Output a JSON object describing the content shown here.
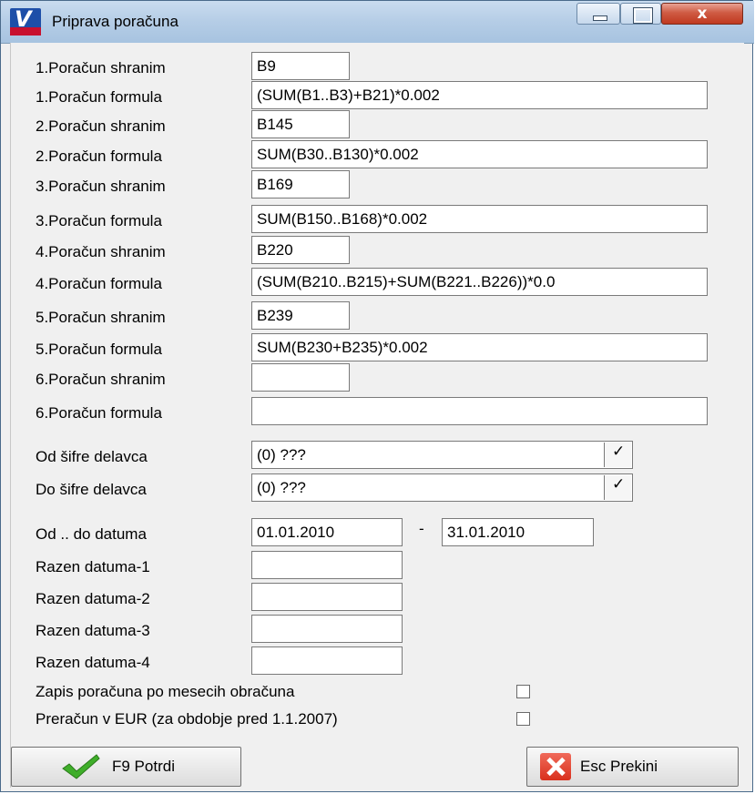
{
  "window": {
    "title": "Priprava poračuna"
  },
  "calculations": [
    {
      "store_label": "1.Poračun shranim",
      "store_value": "B9",
      "formula_label": "1.Poračun formula",
      "formula_value": "(SUM(B1..B3)+B21)*0.002"
    },
    {
      "store_label": "2.Poračun shranim",
      "store_value": "B145",
      "formula_label": "2.Poračun formula",
      "formula_value": "SUM(B30..B130)*0.002"
    },
    {
      "store_label": "3.Poračun shranim",
      "store_value": "B169",
      "formula_label": "3.Poračun formula",
      "formula_value": "SUM(B150..B168)*0.002"
    },
    {
      "store_label": "4.Poračun shranim",
      "store_value": "B220",
      "formula_label": "4.Poračun formula",
      "formula_value": "(SUM(B210..B215)+SUM(B221..B226))*0.0"
    },
    {
      "store_label": "5.Poračun shranim",
      "store_value": "B239",
      "formula_label": "5.Poračun formula",
      "formula_value": "SUM(B230+B235)*0.002"
    },
    {
      "store_label": "6.Poračun shranim",
      "store_value": "",
      "formula_label": "6.Poračun formula",
      "formula_value": ""
    }
  ],
  "workers": {
    "from_label": "Od šifre delavca",
    "from_value": "(0) ???",
    "to_label": "Do šifre delavca",
    "to_value": "(0) ???",
    "dropdown_glyph": "✓"
  },
  "dates": {
    "range_label": "Od .. do datuma",
    "from": "01.01.2010",
    "separator": "-",
    "to": "31.01.2010",
    "except_1_label": "Razen datuma-1",
    "except_1": "",
    "except_2_label": "Razen datuma-2",
    "except_2": "",
    "except_3_label": "Razen datuma-3",
    "except_3": "",
    "except_4_label": "Razen datuma-4",
    "except_4": ""
  },
  "options": {
    "monthly_label": "Zapis poračuna po mesecih obračuna",
    "monthly_checked": false,
    "eur_label": "Preračun v EUR (za obdobje pred 1.1.2007)",
    "eur_checked": false
  },
  "buttons": {
    "confirm": "F9 Potrdi",
    "cancel": "Esc Prekini"
  },
  "titlebar_buttons": {
    "close_glyph": "x"
  },
  "colors": {
    "accent_check": "#3fae2a",
    "cancel_icon": "#d9301c",
    "titlebar": "#b5cde6"
  }
}
